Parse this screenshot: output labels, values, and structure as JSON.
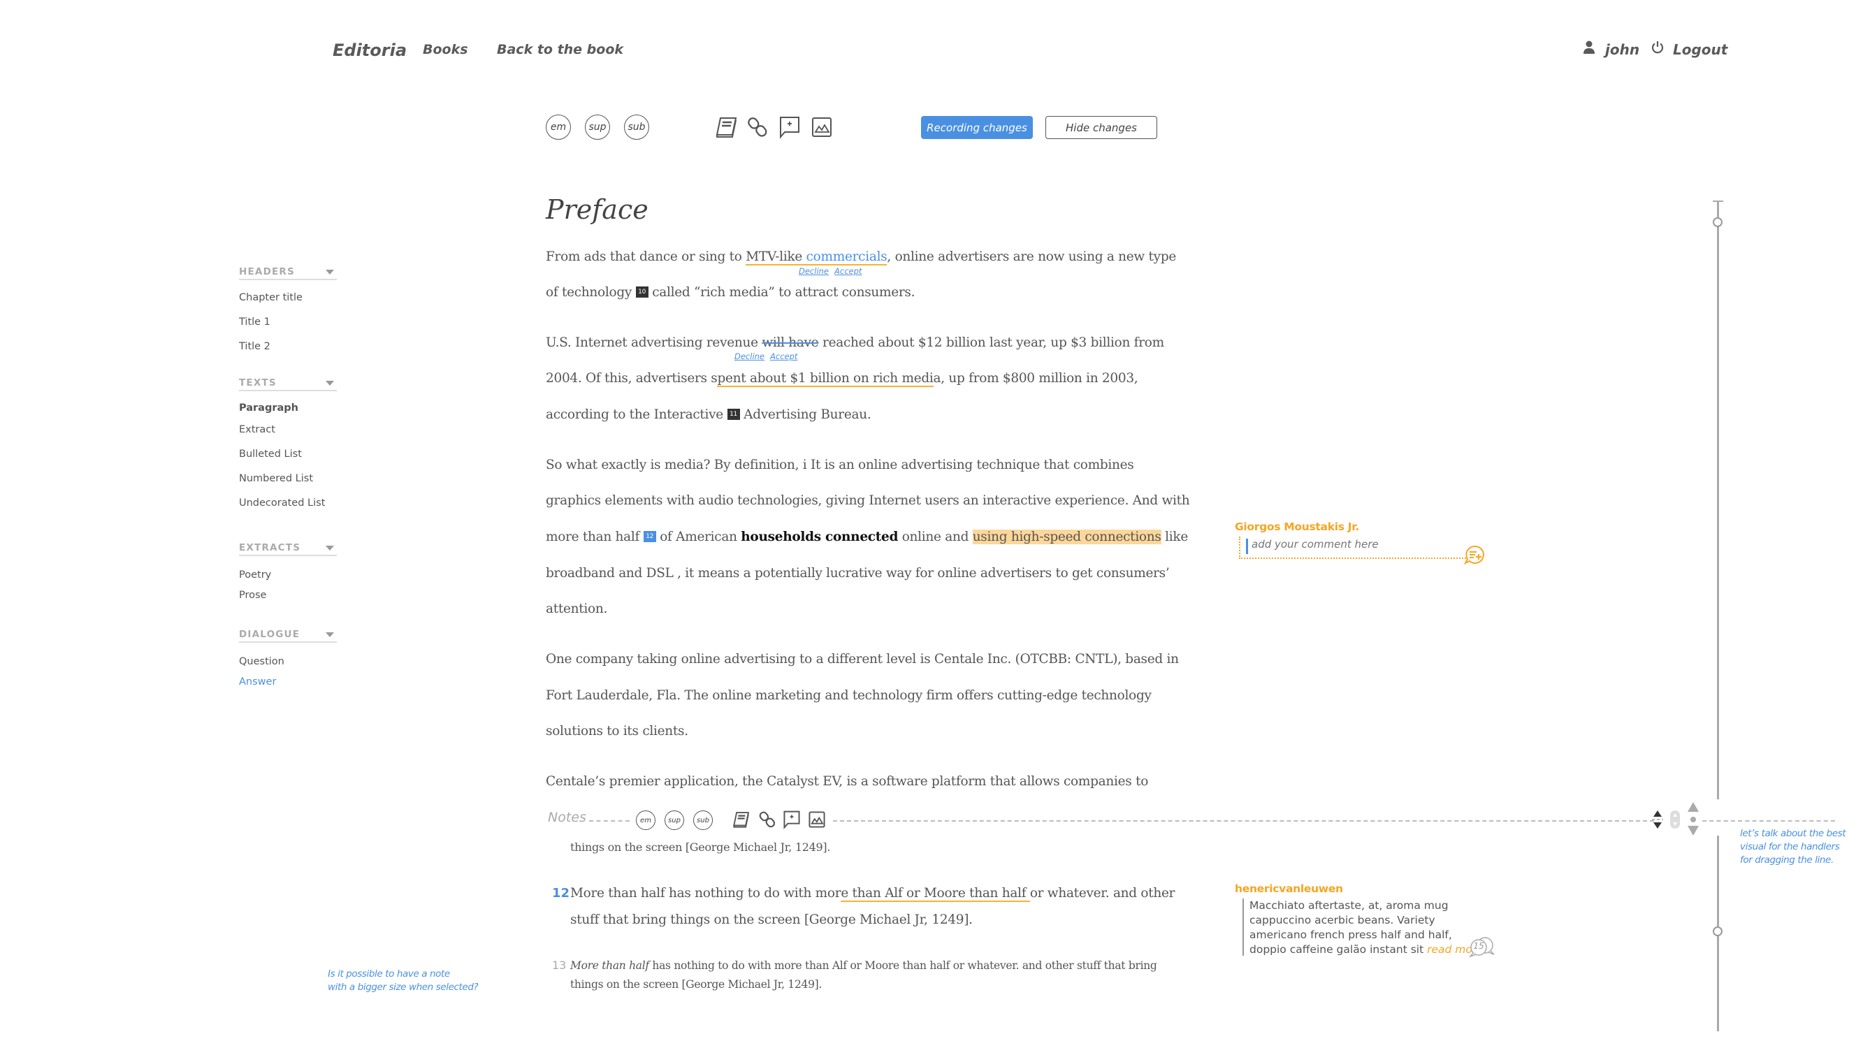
{
  "nav": {
    "logo": "Editoria",
    "books": "Books",
    "back": "Back to the book",
    "user": "john",
    "logout": "Logout",
    "user_icon": "user-icon",
    "logout_icon": "power-icon"
  },
  "toolbar": {
    "em": "em",
    "sup": "sup",
    "sub": "sub",
    "icons": [
      "book-icon",
      "link-icon",
      "add-comment-icon",
      "image-icon"
    ],
    "recording": "Recording changes",
    "hide": "Hide changes"
  },
  "colors": {
    "accent": "#4a90e2",
    "change_underline": "#f9b233",
    "highlight": "#fcd79a",
    "comment_author": "#f5a623"
  },
  "sidebar": {
    "headers": {
      "title": "HEADERS",
      "items": [
        "Chapter title",
        "Title 1",
        "Title 2"
      ]
    },
    "texts": {
      "title": "TEXTS",
      "items": [
        "Paragraph",
        "Extract",
        "Bulleted List",
        "Numbered List",
        "Undecorated List"
      ],
      "active": "Paragraph"
    },
    "extracts": {
      "title": "EXTRACTS",
      "items": [
        "Poetry",
        "Prose"
      ]
    },
    "dialogue": {
      "title": "DIALOGUE",
      "items": [
        "Question",
        "Answer"
      ],
      "selected": "Answer"
    }
  },
  "document": {
    "title": "Preface",
    "p1": {
      "l1a": "From ads that dance or sing to ",
      "l1_changed": "MTV-like ",
      "l1_inserted": "commercials",
      "l1b": ", online advertisers are now using a new type",
      "l2a": "of technology ",
      "note_10": "10",
      "l2b": " called “rich media” to attract consumers."
    },
    "p2": {
      "l1a": "U.S. Internet advertising revenue ",
      "l1_deleted": "will have",
      "l1b": " reached about $12 billion last year, up $3 billion from",
      "l2a": "2004. Of this, advertisers s",
      "l2_changed": "pent about $1 billion on rich medi",
      "l2b": "a, up from $800 million  in 2003,",
      "l3a": "according to the Interactive ",
      "note_11": "11",
      "l3b": " Advertising Bureau."
    },
    "p3": {
      "l1": "So what exactly is media? By definition, i It is an online advertising technique that combines",
      "l2": "graphics elements with audio technologies, giving Internet users an interactive experience. And with",
      "l3a": "more than half ",
      "note_12": "12",
      "l3b": " of American ",
      "l3_bold": "households connected",
      "l3c": " online and ",
      "l3_highlight": "using high-speed connections",
      "l3d": " like",
      "l4": "broadband and DSL , it means a potentially lucrative way for online advertisers to get consumers’",
      "l5": "attention."
    },
    "p4": {
      "l1": "One company taking online advertising to a different level is Centale Inc. (OTCBB: CNTL), based in",
      "l2": "Fort Lauderdale, Fla. The online marketing and technology firm offers cutting-edge technology",
      "l3": "solutions to its clients."
    },
    "p5": {
      "l1": "Centale’s premier application, the Catalyst EV, is a software platform that allows companies to"
    },
    "track_actions": {
      "decline": "Decline",
      "accept": "Accept"
    }
  },
  "notes": {
    "label": "Notes",
    "em": "em",
    "sup": "sup",
    "sub": "sub",
    "prev_tail": "things on the screen [George Michael Jr, 1249].",
    "items": [
      {
        "number": "12",
        "l1a": "More than half has nothing to do with mor",
        "l1_changed": "e than Alf or Moore than half ",
        "l1b": "or whatever. and other",
        "l2": "stuff that bring things on the screen  [George Michael Jr, 1249]."
      },
      {
        "number": "13",
        "l1_italic": "More than half",
        "l1": " has nothing to do with more than Alf or Moore than half or whatever. and other stuff that bring",
        "l2": "things on the screen [George Michael Jr, 1249]."
      }
    ]
  },
  "comments": [
    {
      "author": "Giorgos Moustakis Jr.",
      "placeholder": "add your comment here",
      "icon": "add-comment-icon"
    },
    {
      "author": "henericvanleuwen",
      "lines": [
        "Macchiato aftertaste, at, aroma mug",
        "cappuccino acerbic beans. Variety",
        "americano french press half and half,",
        "doppio caffeine galão instant sit "
      ],
      "read_more": "read more",
      "reply_count": "15"
    }
  ],
  "annotations": {
    "note_size": [
      "Is it possible to have a note",
      "with a bigger size when selected?"
    ],
    "handlers": [
      "let’s talk about the best",
      "visual for the handlers",
      "for dragging the line."
    ]
  }
}
